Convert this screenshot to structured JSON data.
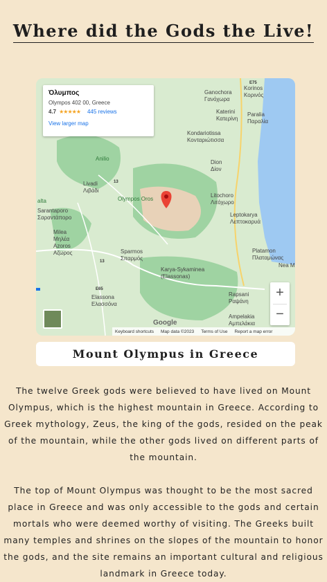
{
  "page": {
    "title": "Where did the Gods the Live!"
  },
  "map": {
    "info": {
      "name": "Όλυμπος",
      "address": "Olympos 402 00, Greece",
      "rating": "4.7",
      "stars": "★★★★★",
      "reviews": "445 reviews",
      "larger_map": "View larger map"
    },
    "labels": [
      {
        "text": "Korinos\nΚορινός"
      },
      {
        "text": "Ganochora\nΓανόχωρα"
      },
      {
        "text": "Katerini\nΚατερίνη"
      },
      {
        "text": "Paralia\nΠαραλία"
      },
      {
        "text": "Kondariotissa\nΚονταριώτισσα"
      },
      {
        "text": "Dion\nΔίον"
      },
      {
        "text": "Anilio"
      },
      {
        "text": "Livadi\nΛιβάδι"
      },
      {
        "text": "Olympos Oros"
      },
      {
        "text": "Litochoro\nΛιτόχωρο"
      },
      {
        "text": "alta"
      },
      {
        "text": "Sarantaporo\nΣαραντάπορο"
      },
      {
        "text": "Leptokarya\nΛεπτοκαρυά"
      },
      {
        "text": "Milea\nΜηλέα"
      },
      {
        "text": "Azoros\nΑζωρος"
      },
      {
        "text": "Sparmos\nΣπαρμός"
      },
      {
        "text": "Platamon\nΠλαταμώνας"
      },
      {
        "text": "Nea M"
      },
      {
        "text": "Karya-Sykaminea\n(Elassonas)"
      },
      {
        "text": "Elassona\nΕλασσόνα"
      },
      {
        "text": "Rapsani\nΡαψάνη"
      },
      {
        "text": "Ampelakia\nΑμπελάκια"
      },
      {
        "text": "E75"
      },
      {
        "text": "13"
      },
      {
        "text": "13"
      },
      {
        "text": "E65"
      }
    ],
    "zoom_in": "+",
    "zoom_out": "−",
    "google": "Google",
    "attribution": [
      "Keyboard shortcuts",
      "Map data ©2023",
      "Terms of Use",
      "Report a map error"
    ]
  },
  "caption": "Mount Olympus in Greece",
  "paragraphs": [
    "The twelve Greek gods were believed to have lived on Mount Olympus, which is the highest mountain in Greece. According to Greek mythology, Zeus, the king of the gods, resided on the peak of the mountain, while the other gods lived on different parts of the mountain.",
    "The top of Mount Olympus was thought to be the most sacred place in Greece and was only accessible to the gods and certain mortals who were deemed worthy of visiting. The Greeks built many temples and shrines on the slopes of the mountain to honor the gods, and the site remains an important cultural and religious landmark in Greece today."
  ],
  "colors": {
    "background": "#f5e6cc",
    "sea": "#9ec9f2",
    "land": "#d9ebd0",
    "forest": "#9fd3a2",
    "peak": "#e8d2b8",
    "pin": "#ea4335"
  }
}
